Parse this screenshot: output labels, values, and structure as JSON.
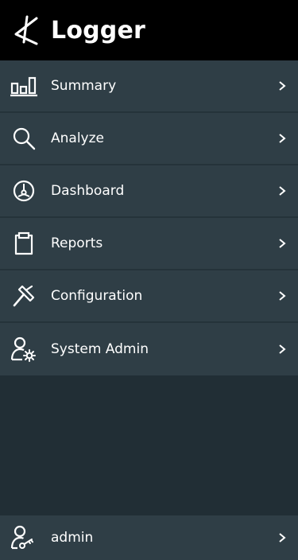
{
  "header": {
    "title": "Logger",
    "logo_icon": "logger-logo-icon"
  },
  "menu": {
    "items": [
      {
        "label": "Summary",
        "icon": "bar-chart-icon"
      },
      {
        "label": "Analyze",
        "icon": "search-icon"
      },
      {
        "label": "Dashboard",
        "icon": "dashboard-gauge-icon"
      },
      {
        "label": "Reports",
        "icon": "clipboard-icon"
      },
      {
        "label": "Configuration",
        "icon": "hammer-icon"
      },
      {
        "label": "System Admin",
        "icon": "user-gear-icon"
      }
    ]
  },
  "footer": {
    "user_label": "admin",
    "icon": "user-key-icon"
  },
  "colors": {
    "header_bg": "#000000",
    "menu_bg": "#2f3e46",
    "panel_bg": "#212e35",
    "text": "#ffffff"
  }
}
